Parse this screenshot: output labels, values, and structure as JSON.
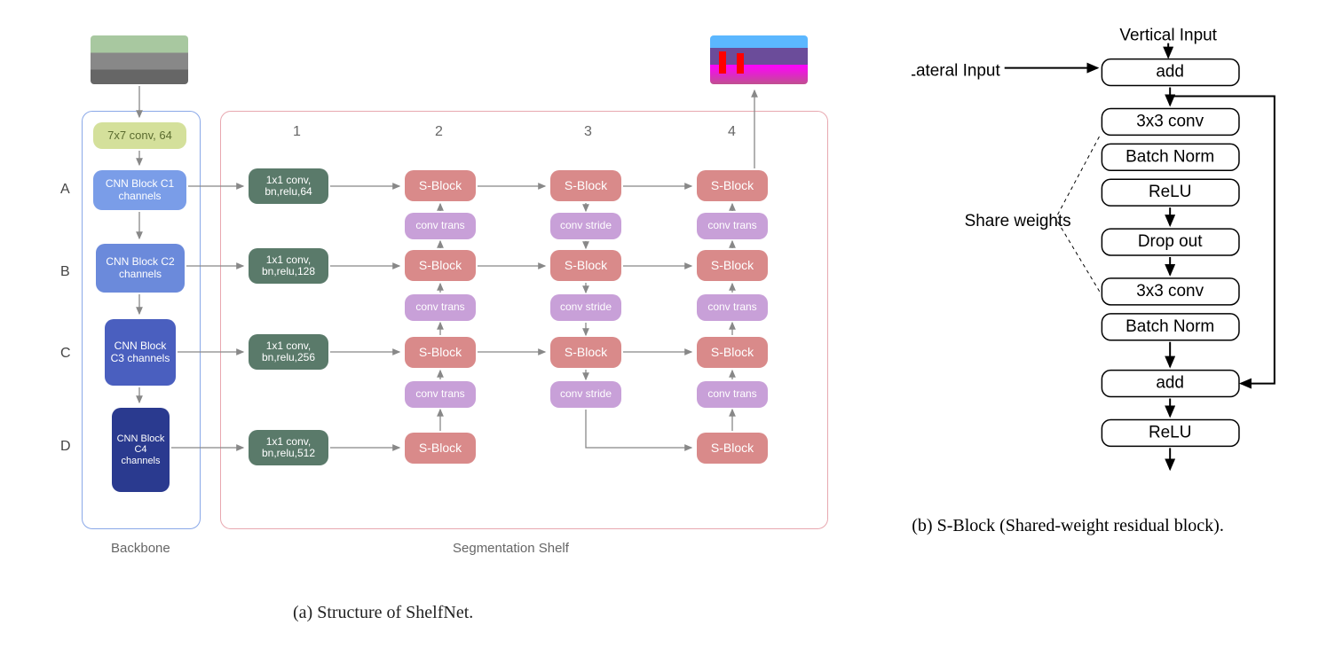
{
  "left": {
    "rows": [
      "A",
      "B",
      "C",
      "D"
    ],
    "cols": [
      "1",
      "2",
      "3",
      "4"
    ],
    "conv7x7": "7x7 conv, 64",
    "cnn": [
      "CNN Block C1 channels",
      "CNN Block C2 channels",
      "CNN Block C3 channels",
      "CNN Block C4 channels"
    ],
    "conv1x1": [
      "1x1 conv, bn,relu,64",
      "1x1 conv, bn,relu,128",
      "1x1 conv, bn,relu,256",
      "1x1 conv, bn,relu,512"
    ],
    "sblock": "S-Block",
    "conv_trans": "conv trans",
    "conv_stride": "conv stride",
    "backbone_label": "Backbone",
    "shelf_label": "Segmentation Shelf",
    "caption": "(a) Structure of ShelfNet."
  },
  "right": {
    "vertical_input": "Vertical Input",
    "lateral_input": "Lateral Input",
    "share_weights": "Share weights",
    "blocks": [
      "add",
      "3x3 conv",
      "Batch Norm",
      "ReLU",
      "Drop out",
      "3x3 conv",
      "Batch Norm",
      "add",
      "ReLU"
    ],
    "caption": "(b) S-Block (Shared-weight residual block)."
  }
}
